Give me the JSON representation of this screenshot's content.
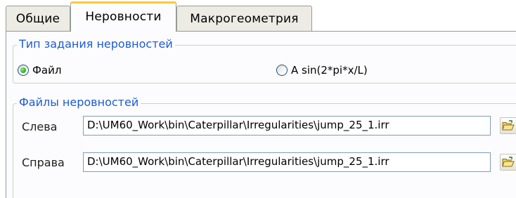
{
  "tabs": [
    {
      "label": "Общие",
      "active": false
    },
    {
      "label": "Неровности",
      "active": true
    },
    {
      "label": "Макрогеометрия",
      "active": false
    }
  ],
  "irregularity_type": {
    "title": "Тип задания неровностей",
    "options": [
      {
        "label": "Файл",
        "checked": true
      },
      {
        "label": "A sin(2*pi*x/L)",
        "checked": false
      }
    ]
  },
  "irregularity_files": {
    "title": "Файлы неровностей",
    "left": {
      "label": "Слева",
      "value": "D:\\UM60_Work\\bin\\Caterpillar\\Irregularities\\jump_25_1.irr"
    },
    "right": {
      "label": "Справа",
      "value": "D:\\UM60_Work\\bin\\Caterpillar\\Irregularities\\jump_25_1.irr"
    }
  },
  "icons": {
    "browse": "open-folder-icon"
  },
  "colors": {
    "group_title": "#1f5bd0",
    "active_tab_accent": "#ffc83c",
    "radio_checked": "#34b520"
  }
}
